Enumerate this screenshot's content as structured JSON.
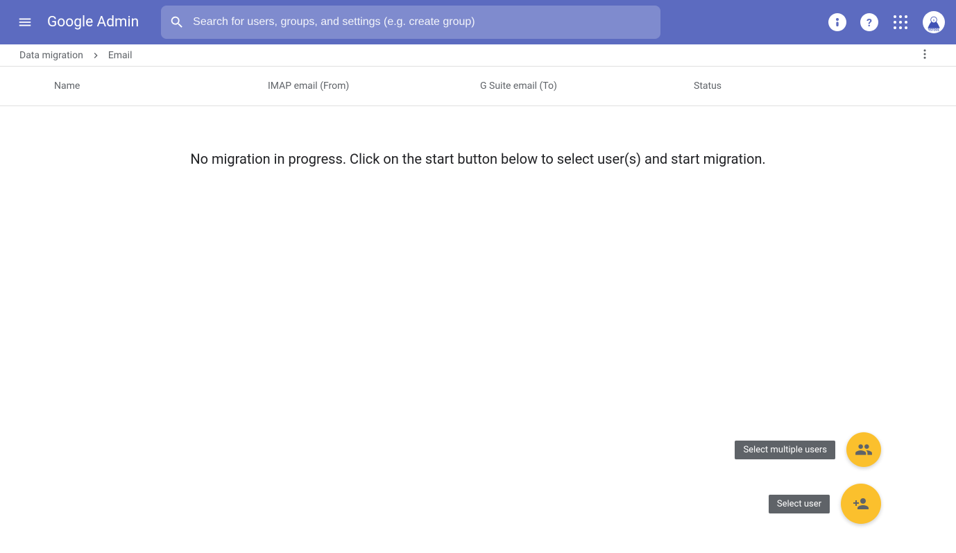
{
  "header": {
    "app_title": "Google Admin",
    "search_placeholder": "Search for users, groups, and settings (e.g. create group)"
  },
  "breadcrumb": {
    "root": "Data migration",
    "current": "Email"
  },
  "table": {
    "columns": {
      "name": "Name",
      "from": "IMAP email (From)",
      "to": "G Suite email (To)",
      "status": "Status"
    }
  },
  "empty_message": "No migration in progress. Click on the start button below to select user(s) and start migration.",
  "fab": {
    "multiple_tooltip": "Select multiple users",
    "single_tooltip": "Select user"
  }
}
